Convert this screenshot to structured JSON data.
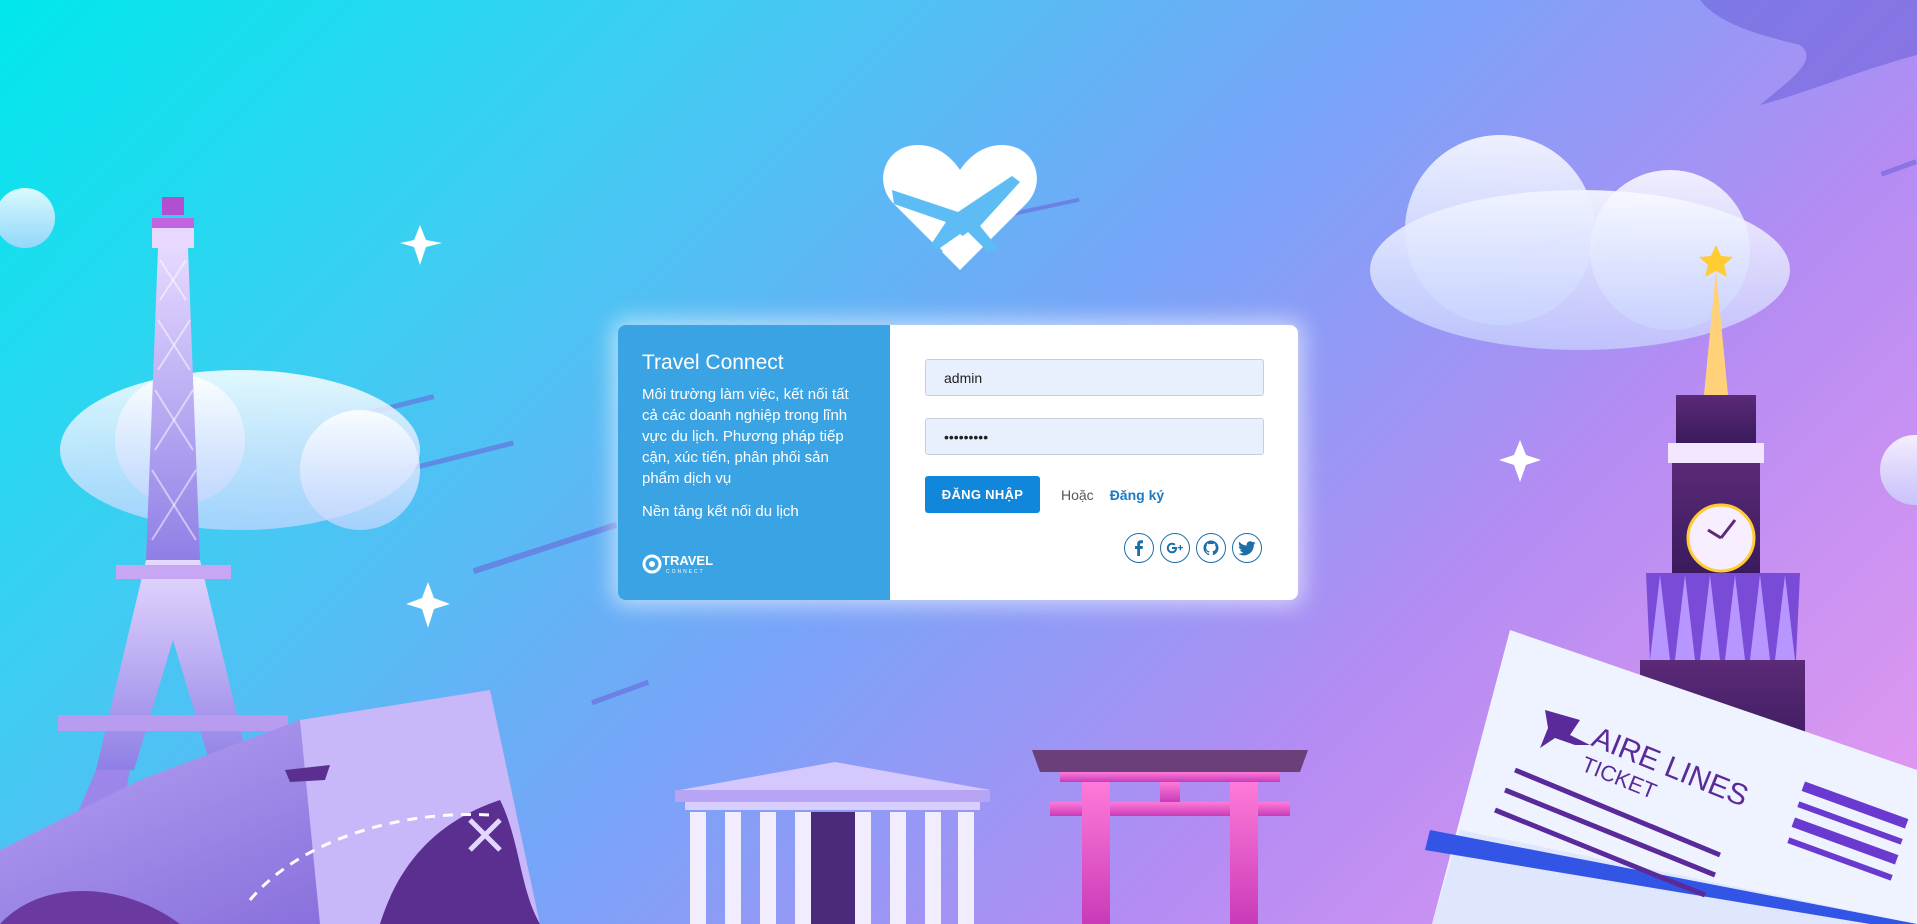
{
  "brand": {
    "title": "Travel Connect",
    "description": "Môi trường làm việc, kết nối tất cả các doanh nghiệp trong lĩnh vực du lịch. Phương pháp tiếp cận, xúc tiến, phân phối sản phẩm dịch vụ",
    "tagline": "Nền tảng kết nối du lịch",
    "logo_text": "TRAVEL",
    "logo_subtext": "CONNECT"
  },
  "login": {
    "username_value": "admin",
    "password_value": "•••••••••",
    "login_button": "ĐĂNG NHẬP",
    "or_text": "Hoặc",
    "register_link": "Đăng ký"
  },
  "socials": [
    {
      "name": "facebook-icon"
    },
    {
      "name": "google-plus-icon"
    },
    {
      "name": "github-icon"
    },
    {
      "name": "twitter-icon"
    }
  ],
  "illustration": {
    "ticket_title": "AIRE LINES",
    "ticket_subtitle": "TICKET"
  },
  "colors": {
    "panel_blue": "#3aa3e3",
    "button_blue": "#1187db",
    "link_blue": "#1a7bc6",
    "field_bg": "#e8f0fe"
  }
}
